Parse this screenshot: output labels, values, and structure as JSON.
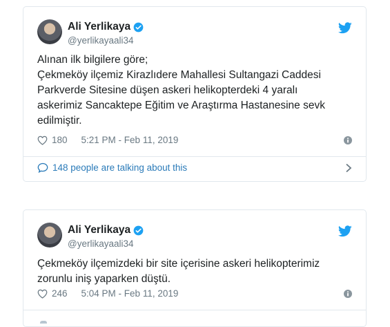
{
  "tweets": [
    {
      "author": {
        "name": "Ali Yerlikaya",
        "handle": "@yerlikayaali34"
      },
      "lines": [
        "Alınan ilk bilgilere göre;",
        "Çekmeköy ilçemiz Kirazlıdere Mahallesi Sultangazi Caddesi",
        "Parkverde Sitesine düşen askeri helikopterdeki 4 yaralı",
        "askerimiz Sancaktepe Eğitim ve Araştırma Hastanesine sevk",
        "edilmiştir."
      ],
      "likes": "180",
      "timestamp": "5:21 PM - Feb 11, 2019",
      "talking": "148 people are talking about this"
    },
    {
      "author": {
        "name": "Ali Yerlikaya",
        "handle": "@yerlikayaali34"
      },
      "lines": [
        "Çekmeköy ilçemizdeki bir site içerisine askeri helikopterimiz",
        "zorunlu iniş yaparken düştü."
      ],
      "likes": "246",
      "timestamp": "5:04 PM - Feb 11, 2019"
    }
  ],
  "colors": {
    "link": "#2b7bb9",
    "verified": "#1da1f2",
    "muted": "#697882",
    "border": "#e1e8ed"
  },
  "icons": [
    "verified-badge-icon",
    "twitter-bird-icon",
    "heart-icon",
    "info-icon",
    "speech-bubble-icon",
    "chevron-right-icon"
  ]
}
